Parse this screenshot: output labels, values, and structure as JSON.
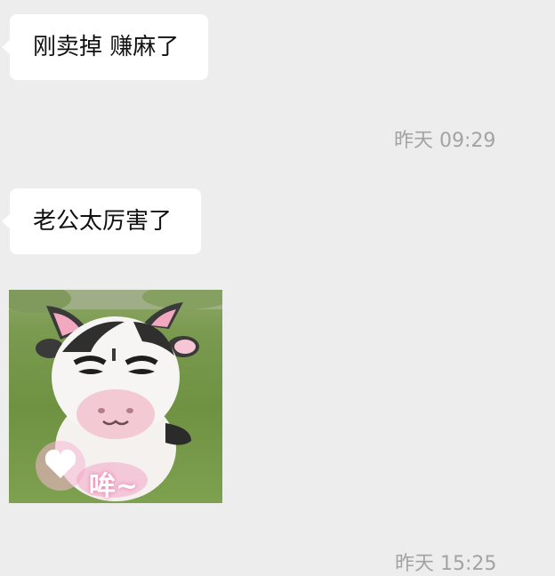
{
  "messages": [
    {
      "type": "text",
      "text": "刚卖掉 赚麻了"
    },
    {
      "type": "timestamp",
      "text": "昨天 09:29"
    },
    {
      "type": "text",
      "text": "老公太厉害了"
    },
    {
      "type": "sticker",
      "caption": "哞~",
      "description_icon": "cow-sticker-icon"
    },
    {
      "type": "timestamp",
      "text": "昨天 15:25"
    }
  ],
  "colors": {
    "background": "#ededed",
    "bubble": "#ffffff",
    "timestamp_text": "#a3a3a3"
  }
}
